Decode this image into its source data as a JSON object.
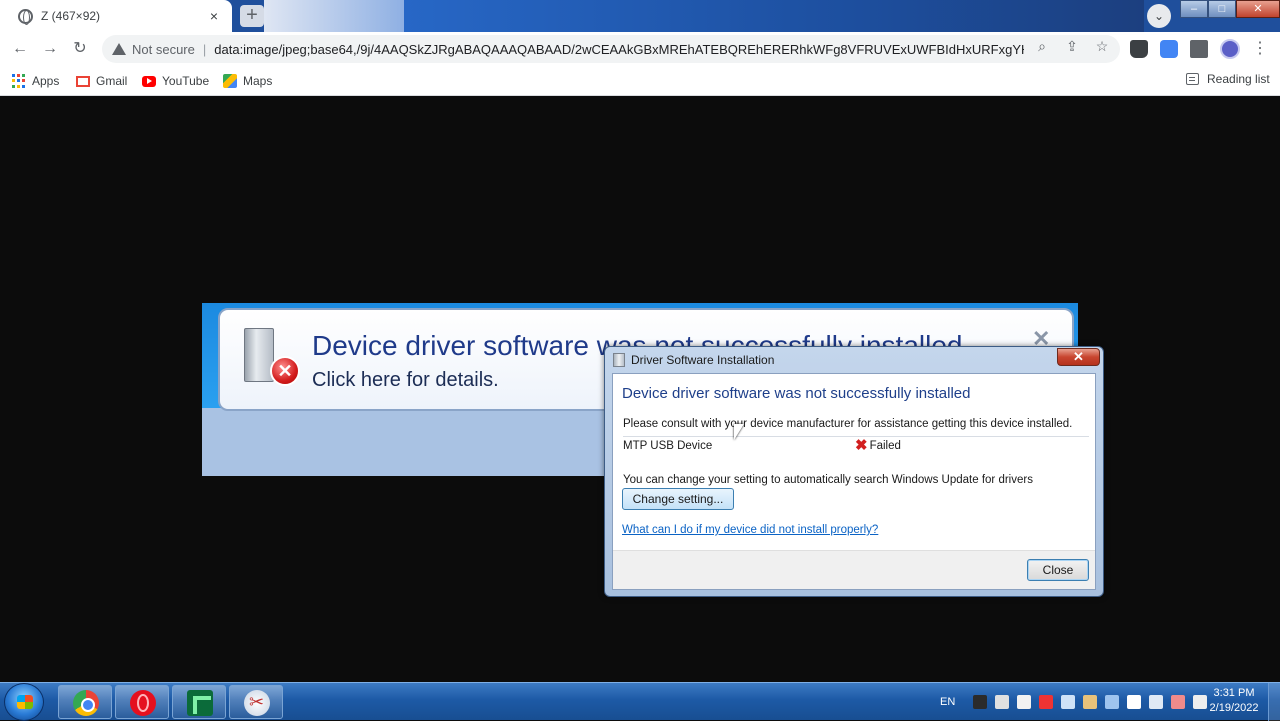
{
  "browser": {
    "tab_title": "Z (467×92)",
    "tab_close": "×",
    "new_tab": "+",
    "omnibox": {
      "security_label": "Not secure",
      "separator": "|",
      "url": "data:image/jpeg;base64,/9j/4AAQSkZJRgABAQAAAQABAAD/2wCEAAkGBxMREhATEBQREhERERhkWFg8VFRUVExUWFBIdHxURFxgYHCshGR..."
    },
    "bookmarks": [
      {
        "label": "Apps",
        "icon": "apps-icon"
      },
      {
        "label": "Gmail",
        "icon": "gmail-icon"
      },
      {
        "label": "YouTube",
        "icon": "youtube-icon"
      },
      {
        "label": "Maps",
        "icon": "maps-icon"
      }
    ],
    "reading_list": "Reading list",
    "window_controls": {
      "minimize": "–",
      "maximize": "□",
      "close": "✕"
    }
  },
  "notification": {
    "title": "Device driver software was not successfully installed",
    "subtitle": "Click here for details.",
    "close": "✕"
  },
  "dialog": {
    "caption": "Driver Software Installation",
    "close_glyph": "✕",
    "heading": "Device driver software was not successfully installed",
    "consult_text": "Please consult with your device manufacturer for assistance getting this device installed.",
    "device_name": "MTP USB Device",
    "status": "Failed",
    "change_text": "You can change your setting to automatically search Windows Update for drivers",
    "change_button": "Change setting...",
    "help_link": "What can I do if my device did not install properly?",
    "close_button": "Close"
  },
  "taskbar": {
    "language": "EN",
    "time": "3:31 PM",
    "date": "2/19/2022",
    "apps": [
      "chrome-icon",
      "opera-icon",
      "camtasia-icon",
      "snipping-tool-icon"
    ]
  },
  "colors": {
    "accent": "#1e3f8a",
    "error": "#d21f1f",
    "link": "#0b63c5",
    "taskbar": "#1d5aa6"
  }
}
